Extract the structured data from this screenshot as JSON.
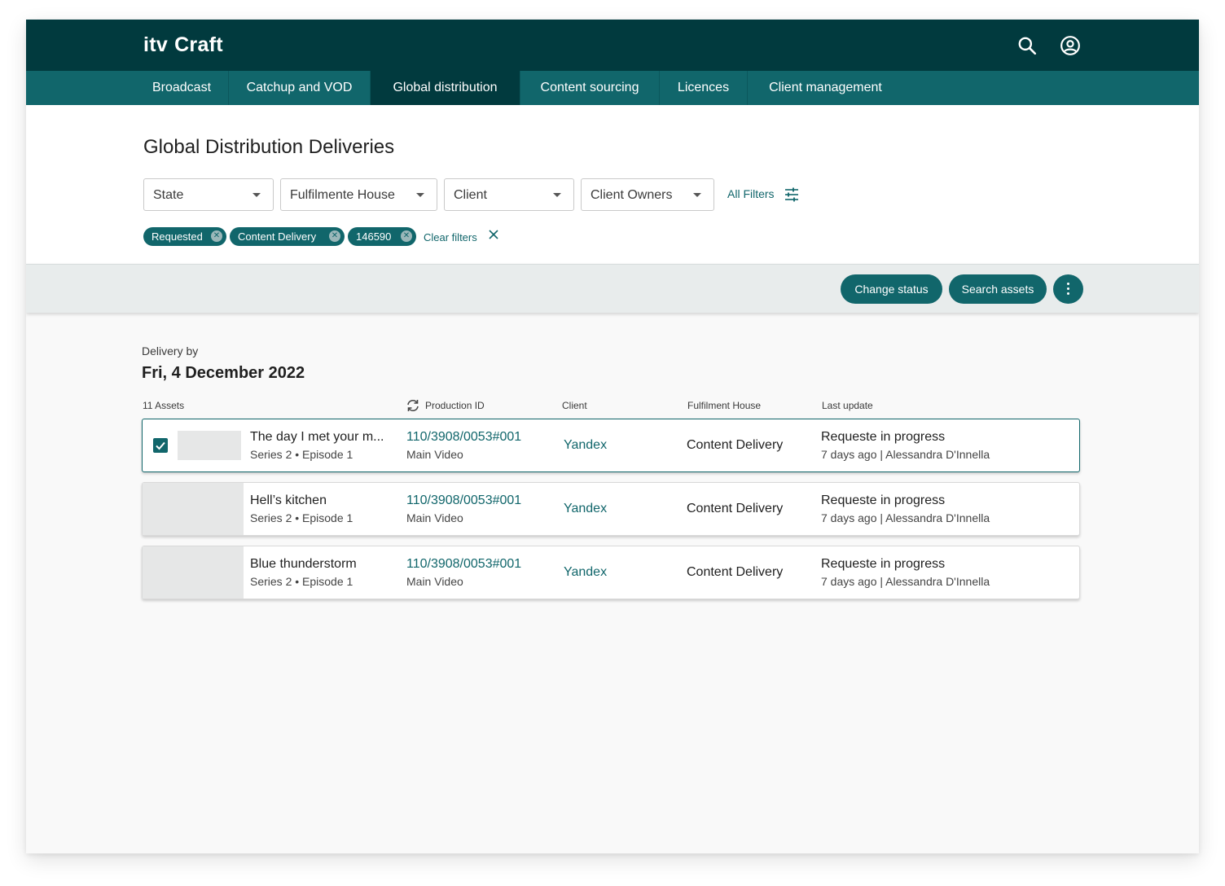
{
  "app": {
    "logo_mark": "itv",
    "logo_text": "Craft",
    "icons": {
      "search": "search-icon",
      "account": "account-circle-icon"
    }
  },
  "nav": {
    "tabs": [
      {
        "label": "Broadcast",
        "active": false
      },
      {
        "label": "Catchup and VOD",
        "active": false
      },
      {
        "label": "Global distribution",
        "active": true
      },
      {
        "label": "Content sourcing",
        "active": false
      },
      {
        "label": "Licences",
        "active": false
      },
      {
        "label": "Client management",
        "active": false
      }
    ]
  },
  "page": {
    "title": "Global Distribution Deliveries"
  },
  "filters": {
    "selects": [
      {
        "label": "State"
      },
      {
        "label": "Fulfilmente House"
      },
      {
        "label": "Client"
      },
      {
        "label": "Client Owners"
      }
    ],
    "all_filters_label": "All Filters",
    "chips": [
      {
        "label": "Requested"
      },
      {
        "label": "Content Delivery"
      },
      {
        "label": "146590"
      }
    ],
    "clear_label": "Clear filters"
  },
  "actions": {
    "change_status": "Change status",
    "search_assets": "Search assets"
  },
  "delivery": {
    "by_label": "Delivery by",
    "date": "Fri, 4 December 2022",
    "columns": {
      "assets": "11 Assets",
      "production_id": "Production ID",
      "client": "Client",
      "house": "Fulfilment House",
      "last_update": "Last update"
    },
    "rows": [
      {
        "selected": true,
        "title": "The day I met your m...",
        "subtitle": "Series 2 • Episode 1",
        "production_id": "110/3908/0053#001",
        "production_type": "Main Video",
        "client": "Yandex",
        "house": "Content Delivery",
        "status": "Requeste in progress",
        "meta": "7 days ago | Alessandra D'Innella"
      },
      {
        "selected": false,
        "title": "Hell’s kitchen",
        "subtitle": "Series 2 • Episode 1",
        "production_id": "110/3908/0053#001",
        "production_type": "Main Video",
        "client": "Yandex",
        "house": "Content Delivery",
        "status": "Requeste in progress",
        "meta": "7 days ago | Alessandra D'Innella"
      },
      {
        "selected": false,
        "title": "Blue thunderstorm",
        "subtitle": "Series 2 • Episode 1",
        "production_id": "110/3908/0053#001",
        "production_type": "Main Video",
        "client": "Yandex",
        "house": "Content Delivery",
        "status": "Requeste in progress",
        "meta": "7 days ago | Alessandra D'Innella"
      }
    ]
  },
  "colors": {
    "header_bg": "#013a3e",
    "nav_bg": "#11666b",
    "accent": "#11666b",
    "action_bar_bg": "#e8ecec"
  }
}
